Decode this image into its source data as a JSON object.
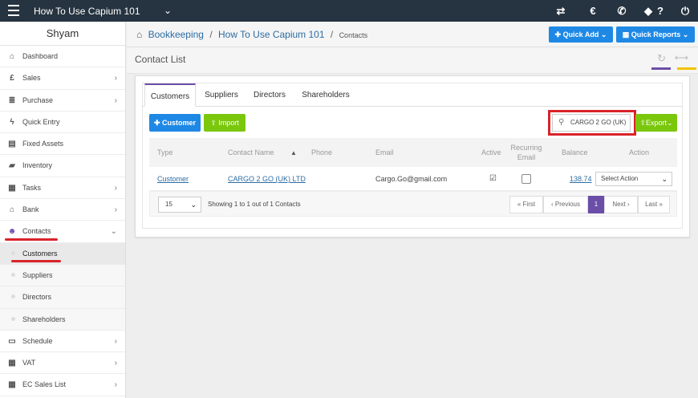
{
  "topbar": {
    "app_title": "How To Use Capium 101",
    "icons": [
      "menu-icon",
      "chevron-down-icon",
      "switch-icon",
      "currency-icon",
      "megaphone-icon",
      "tag-icon",
      "help-icon",
      "power-icon"
    ]
  },
  "sidebar": {
    "user": "Shyam",
    "items": [
      {
        "label": "Dashboard",
        "icon": "dashboard-icon",
        "arrow": false
      },
      {
        "label": "Sales",
        "icon": "pound-icon",
        "arrow": true
      },
      {
        "label": "Purchase",
        "icon": "purchase-icon",
        "arrow": true
      },
      {
        "label": "Quick Entry",
        "icon": "lightning-icon",
        "arrow": false
      },
      {
        "label": "Fixed Assets",
        "icon": "asset-icon",
        "arrow": false
      },
      {
        "label": "Inventory",
        "icon": "truck-icon",
        "arrow": false
      },
      {
        "label": "Tasks",
        "icon": "tasks-icon",
        "arrow": true
      },
      {
        "label": "Bank",
        "icon": "bank-icon",
        "arrow": true
      },
      {
        "label": "Contacts",
        "icon": "users-icon",
        "arrow": true,
        "expanded": true
      }
    ],
    "sub_items": [
      "Customers",
      "Suppliers",
      "Directors",
      "Shareholders"
    ],
    "items_after": [
      {
        "label": "Schedule",
        "icon": "calendar-icon",
        "arrow": true
      },
      {
        "label": "VAT",
        "icon": "calculator-icon",
        "arrow": true
      },
      {
        "label": "EC Sales List",
        "icon": "calculator-icon",
        "arrow": true
      }
    ]
  },
  "breadcrumb": {
    "root": "Bookkeeping",
    "middle": "How To Use Capium 101",
    "current": "Contacts",
    "separator": "/"
  },
  "header_buttons": {
    "quick_add": "Quick Add",
    "quick_reports": "Quick Reports"
  },
  "page_title": "Contact List",
  "tabs": [
    "Customers",
    "Suppliers",
    "Directors",
    "Shareholders"
  ],
  "toolbar": {
    "customer_button": "Customer",
    "import_button": "Import",
    "search_value": "CARGO 2 GO (UK)",
    "export_button": "Export"
  },
  "table": {
    "headers": {
      "type": "Type",
      "contact_name": "Contact Name",
      "phone": "Phone",
      "email": "Email",
      "active": "Active",
      "recurring_line1": "Recurring",
      "recurring_line2": "Email",
      "balance": "Balance",
      "action": "Action"
    },
    "rows": [
      {
        "type": "Customer",
        "contact_name": "CARGO 2 GO (UK) LTD",
        "phone": "",
        "email": "Cargo.Go@gmail.com",
        "active": true,
        "recurring_email": false,
        "balance": "138.74",
        "action": "Select Action"
      }
    ]
  },
  "pagination": {
    "per_page": "15",
    "showing": "Showing 1 to 1 out of 1 Contacts",
    "first": "« First",
    "previous": "‹ Previous",
    "current": "1",
    "next": "Next ›",
    "last": "Last »"
  },
  "colors": {
    "topbar": "#263340",
    "primary_blue": "#1e88e5",
    "green": "#7ac70c",
    "purple": "#6b4ea8",
    "highlight_red": "#d9232a",
    "yellow": "#f2c200"
  }
}
